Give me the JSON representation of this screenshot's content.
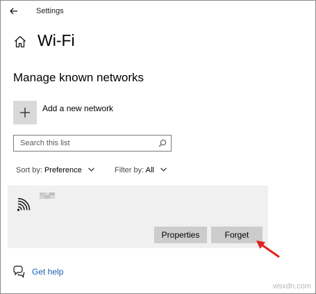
{
  "window": {
    "title": "Settings"
  },
  "page": {
    "title": "Wi-Fi",
    "section_heading": "Manage known networks"
  },
  "add_network": {
    "label": "Add a new network"
  },
  "search": {
    "placeholder": "Search this list",
    "value": ""
  },
  "sort": {
    "prefix": "Sort by:",
    "value": "Preference"
  },
  "filter": {
    "prefix": "Filter by:",
    "value": "All"
  },
  "networks": [
    {
      "name": "",
      "name_redacted": true,
      "icon": "wifi-icon",
      "actions": {
        "properties": "Properties",
        "forget": "Forget"
      }
    }
  ],
  "help": {
    "label": "Get help"
  },
  "watermark": "wsxdn.com",
  "colors": {
    "tile": "#d9d9d9",
    "item_bg": "#f0f0f0",
    "button": "#cccccc",
    "link": "#1a5fb4",
    "annotation_arrow": "#e0201b"
  },
  "icons": [
    "back-arrow-icon",
    "home-icon",
    "plus-icon",
    "search-icon",
    "chevron-down-icon",
    "wifi-icon",
    "help-chat-icon"
  ]
}
